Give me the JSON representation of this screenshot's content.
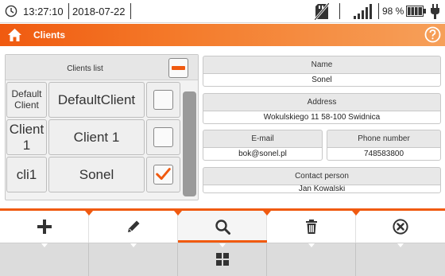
{
  "status_bar": {
    "time": "13:27:10",
    "date": "2018-07-22",
    "battery_percent": "98 %",
    "icons": [
      "clock-icon",
      "sd-card-missing-icon",
      "signal-strength-icon",
      "battery-icon",
      "power-plug-icon"
    ]
  },
  "title_bar": {
    "title": "Clients",
    "icons": [
      "home-icon",
      "help-icon"
    ]
  },
  "clients_list": {
    "header": "Clients list",
    "rows": [
      {
        "short_line1": "Default",
        "short_line2": "Client",
        "name": "DefaultClient",
        "checked": false
      },
      {
        "short_line1": "Client",
        "short_line2": "1",
        "name": "Client 1",
        "checked": false
      },
      {
        "short_line1": "cli1",
        "short_line2": "",
        "name": "Sonel",
        "checked": true
      }
    ]
  },
  "details": {
    "name_label": "Name",
    "name_value": "Sonel",
    "address_label": "Address",
    "address_value": "Wokulskiego 11 58-100 Swidnica",
    "email_label": "E-mail",
    "email_value": "bok@sonel.pl",
    "phone_label": "Phone number",
    "phone_value": "748583800",
    "contact_label": "Contact person",
    "contact_value": "Jan Kowalski"
  },
  "toolbar": {
    "buttons": [
      "add-icon",
      "edit-icon",
      "search-icon",
      "delete-icon",
      "close-icon"
    ],
    "active": "search-icon"
  },
  "colors": {
    "accent": "#f05a10",
    "panel": "#efefef",
    "border": "#bdbdbd"
  }
}
